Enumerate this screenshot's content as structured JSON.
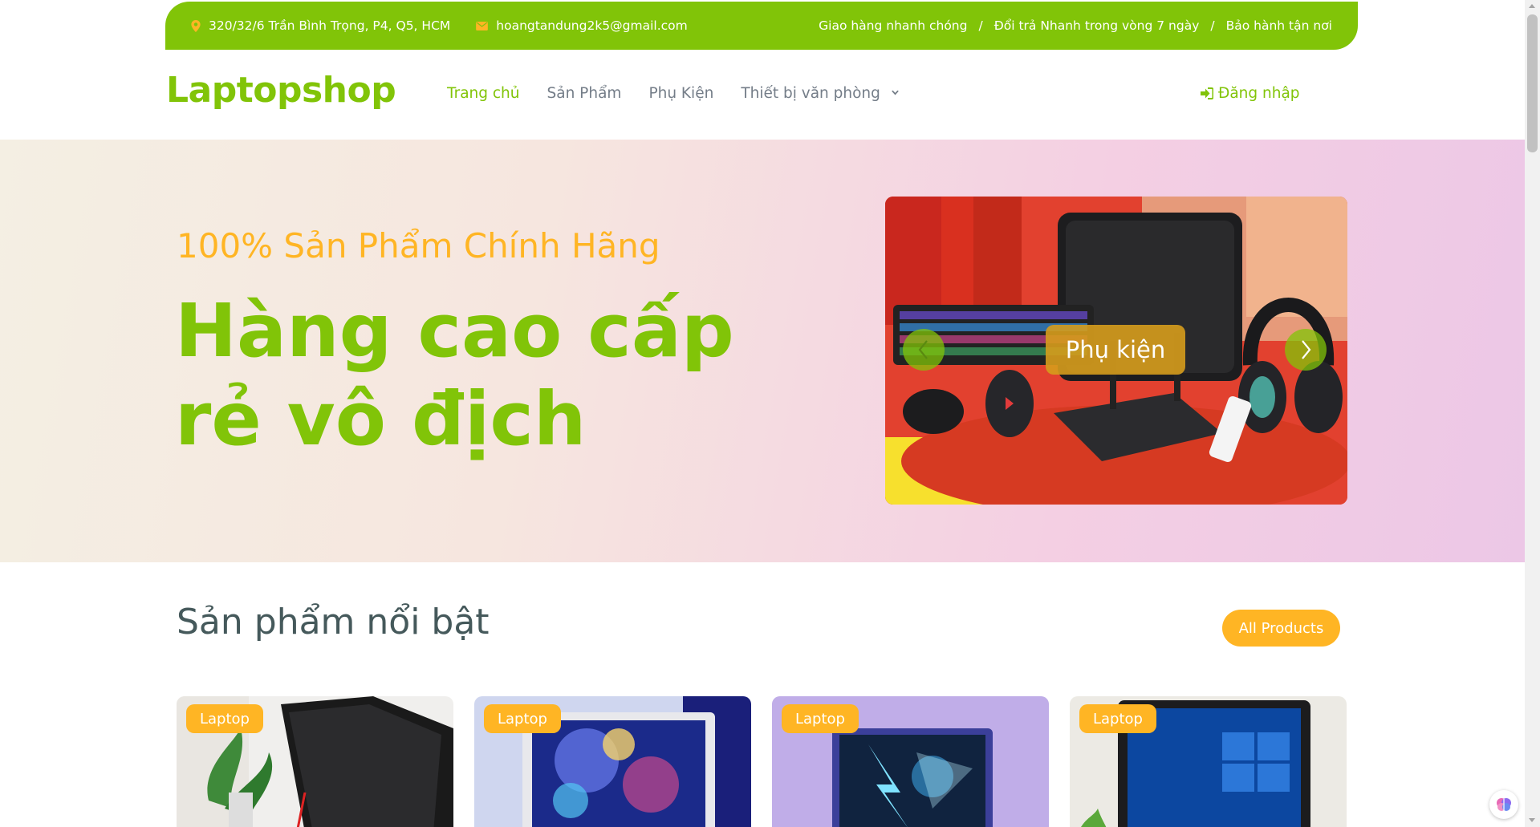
{
  "topbar": {
    "address": "320/32/6 Trần Bình Trọng, P4, Q5, HCM",
    "email": "hoangtandung2k5@gmail.com",
    "policies": [
      "Giao hàng nhanh chóng",
      "Đổi trả Nhanh trong vòng 7 ngày",
      "Bảo hành tận nơi"
    ],
    "separator": "/"
  },
  "navbar": {
    "logo": "Laptopshop",
    "links": [
      "Trang chủ",
      "Sản Phẩm",
      "Phụ Kiện",
      "Thiết bị văn phòng"
    ],
    "active_link": "Trang chủ",
    "login": "Đăng nhập"
  },
  "hero": {
    "subtitle": "100% Sản Phẩm Chính Hãng",
    "title_line1": "Hàng cao cấp",
    "title_line2": "rẻ vô địch",
    "slide_label": "Phụ kiện"
  },
  "featured": {
    "title": "Sản phẩm nổi bật",
    "all_button": "All Products",
    "cards": [
      {
        "badge": "Laptop"
      },
      {
        "badge": "Laptop"
      },
      {
        "badge": "Laptop"
      },
      {
        "badge": "Laptop"
      }
    ]
  },
  "colors": {
    "primary": "#81c408",
    "secondary": "#ffb524",
    "text": "#45595b",
    "nav_text": "#747d88"
  },
  "icons": {
    "address": "map-pin-icon",
    "email": "envelope-icon",
    "login": "sign-in-icon",
    "dropdown": "chevron-down-icon",
    "carousel_prev": "chevron-left-icon",
    "carousel_next": "chevron-right-icon"
  }
}
